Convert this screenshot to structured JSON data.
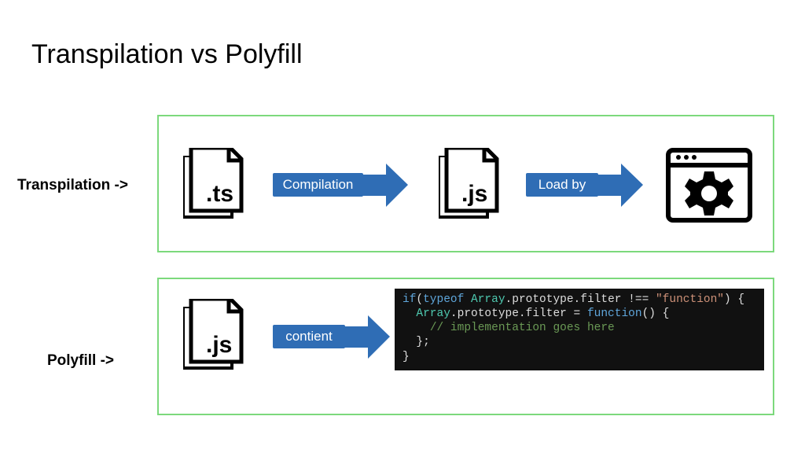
{
  "title": "Transpilation vs Polyfill",
  "labels": {
    "transpilation": "Transpilation ->",
    "polyfill": "Polyfill ->"
  },
  "transpilation": {
    "source_ext": ".ts",
    "arrow1_label": "Compilation",
    "target_ext": ".js",
    "arrow2_label": "Load by"
  },
  "polyfill": {
    "source_ext": ".js",
    "arrow_label": "contient",
    "code": {
      "line1_if": "if",
      "line1_typeof": "typeof",
      "line1_array": "Array",
      "line1_rest": ".prototype.filter !== ",
      "line1_str": "\"function\"",
      "line1_end": ") {",
      "line2_array": "Array",
      "line2_mid": ".prototype.filter = ",
      "line2_fn": "function",
      "line2_end": "() {",
      "line3_comment": "// implementation goes here",
      "line4": "  };",
      "line5": "}"
    }
  },
  "colors": {
    "panel_border": "#7cd97c",
    "arrow": "#2f6db5",
    "code_bg": "#111111"
  }
}
